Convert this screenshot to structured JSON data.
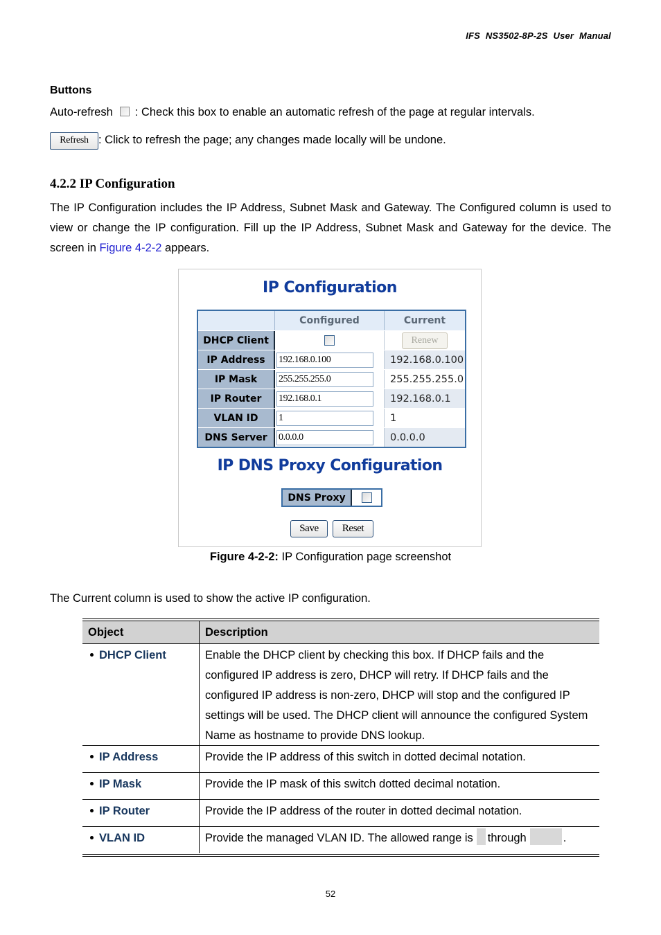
{
  "header": {
    "title": "IFS  NS3502-8P-2S  User  Manual"
  },
  "buttons_section": {
    "heading": "Buttons",
    "auto_refresh_label": "Auto-refresh",
    "auto_refresh_desc": ": Check this box to enable an automatic refresh of the page at regular intervals.",
    "refresh_button_label": "Refresh",
    "refresh_desc": ": Click to refresh the page; any changes made locally will be undone."
  },
  "section": {
    "heading": "4.2.2 IP Configuration",
    "intro_before_link": "The IP Configuration includes the IP Address, Subnet Mask and Gateway. The Configured column is used to view or change the IP configuration. Fill up the IP Address, Subnet Mask and Gateway for the device. The screen in ",
    "intro_link": "Figure 4-2-2",
    "intro_after_link": " appears."
  },
  "figure": {
    "title": "IP Configuration",
    "columns": [
      "",
      "Configured",
      "Current"
    ],
    "dhcp": {
      "label": "DHCP Client",
      "checked": false,
      "renew_label": "Renew"
    },
    "rows": [
      {
        "label": "IP Address",
        "configured": "192.168.0.100",
        "current": "192.168.0.100"
      },
      {
        "label": "IP Mask",
        "configured": "255.255.255.0",
        "current": "255.255.255.0"
      },
      {
        "label": "IP Router",
        "configured": "192.168.0.1",
        "current": "192.168.0.1"
      },
      {
        "label": "VLAN ID",
        "configured": "1",
        "current": "1"
      },
      {
        "label": "DNS Server",
        "configured": "0.0.0.0",
        "current": "0.0.0.0"
      }
    ],
    "dns_title": "IP DNS Proxy Configuration",
    "dns_proxy_label": "DNS Proxy",
    "dns_proxy_checked": false,
    "save_label": "Save",
    "reset_label": "Reset"
  },
  "caption": {
    "label": "Figure 4-2-2:",
    "text": " IP Configuration page screenshot"
  },
  "current_para": "The Current column is used to show the active IP configuration.",
  "desc_table": {
    "headers": [
      "Object",
      "Description"
    ],
    "rows": [
      {
        "object": "DHCP Client",
        "description": "Enable the DHCP client by checking this box. If DHCP fails and the configured IP address is zero, DHCP will retry. If DHCP fails and the configured IP address is non-zero, DHCP will stop and the configured IP settings will be used. The DHCP client will announce the configured System Name as hostname to provide DNS lookup."
      },
      {
        "object": "IP Address",
        "description": "Provide the IP address of this switch in dotted decimal notation."
      },
      {
        "object": "IP Mask",
        "description": "Provide the IP mask of this switch dotted decimal notation."
      },
      {
        "object": "IP Router",
        "description": "Provide the IP address of the router in dotted decimal notation."
      },
      {
        "object": "VLAN ID",
        "description_a": "Provide the managed VLAN ID. The allowed range is",
        "description_b": "through",
        "description_c": "."
      }
    ]
  },
  "page_number": "52"
}
